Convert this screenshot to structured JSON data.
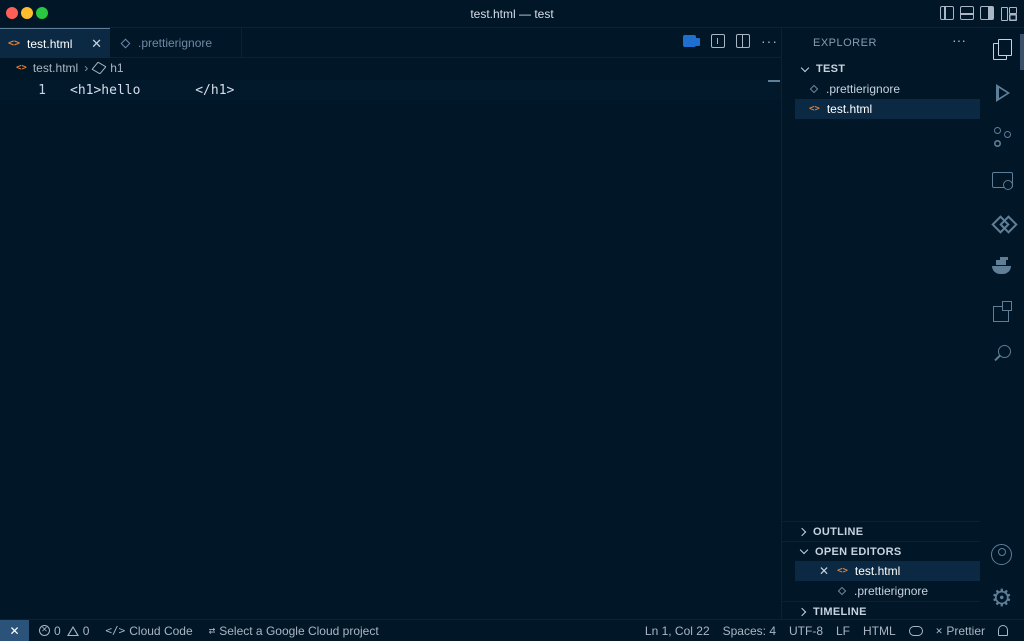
{
  "window": {
    "title": "test.html — test"
  },
  "tabs": [
    {
      "label": "test.html",
      "active": true,
      "icon": "html-file-icon"
    },
    {
      "label": ".prettierignore",
      "active": false,
      "icon": "prettier-file-icon"
    }
  ],
  "breadcrumb": {
    "file": "test.html",
    "symbol": "h1"
  },
  "editor": {
    "lines": [
      {
        "number": "1",
        "text": "<h1>hello       </h1>"
      }
    ]
  },
  "sidebar": {
    "header": "EXPLORER",
    "folder": "TEST",
    "files": [
      {
        "name": ".prettierignore",
        "icon": "prettier-file-icon",
        "selected": false
      },
      {
        "name": "test.html",
        "icon": "html-file-icon",
        "selected": true
      }
    ],
    "sections": {
      "outline": "OUTLINE",
      "open_editors": "OPEN EDITORS",
      "timeline": "TIMELINE"
    },
    "open_editors": [
      {
        "name": "test.html",
        "icon": "html-file-icon",
        "selected": true
      },
      {
        "name": ".prettierignore",
        "icon": "prettier-file-icon",
        "selected": false
      }
    ]
  },
  "statusbar": {
    "errors": "0",
    "warnings": "0",
    "cloud_code": "Cloud Code",
    "gcp_project": "Select a Google Cloud project",
    "position": "Ln 1, Col 22",
    "spaces": "Spaces: 4",
    "encoding": "UTF-8",
    "eol": "LF",
    "language": "HTML",
    "prettier": "Prettier"
  },
  "colors": {
    "background": "#011627",
    "accent": "#1f6fd1",
    "html_icon": "#e5843c",
    "selection": "#0b2942"
  }
}
